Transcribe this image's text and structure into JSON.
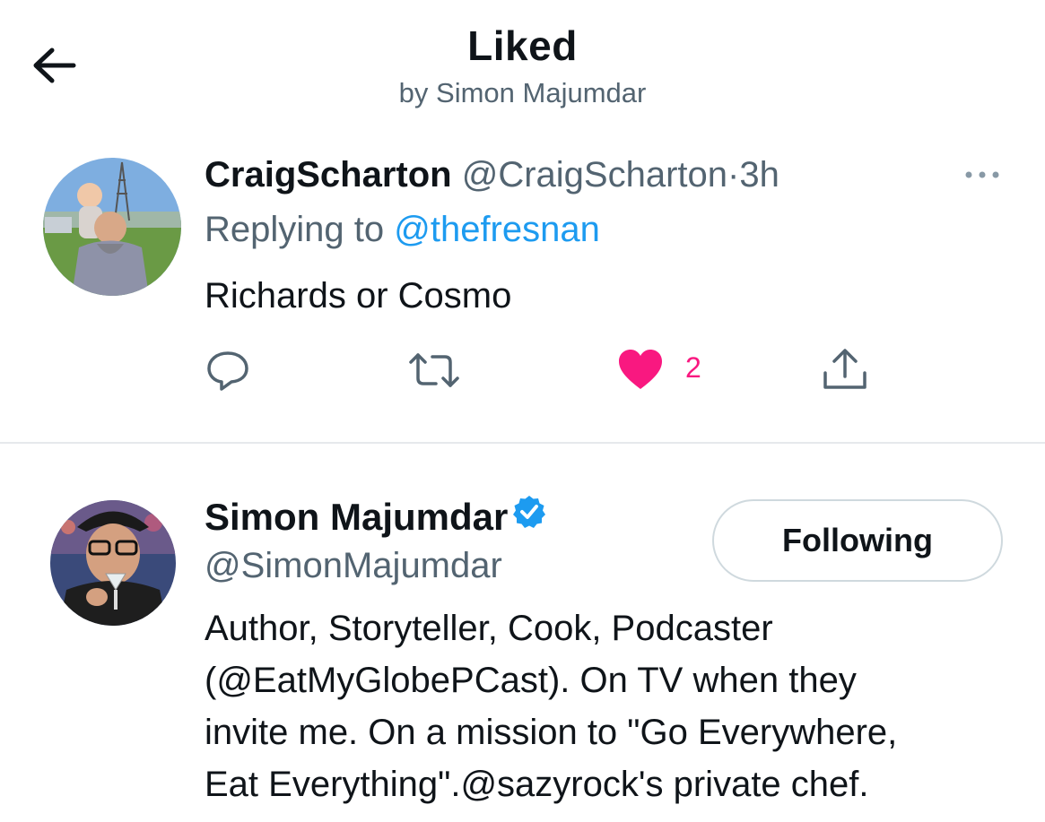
{
  "header": {
    "title": "Liked",
    "subtitle": "by Simon Majumdar"
  },
  "tweet": {
    "author_name": "CraigScharton",
    "author_handle": "@CraigScharton",
    "separator": "·",
    "time": "3h",
    "replying_prefix": "Replying to ",
    "replying_to": "@thefresnan",
    "text": "Richards or Cosmo",
    "like_count": "2",
    "liked": true,
    "like_color": "#f91880"
  },
  "user": {
    "name": "Simon Majumdar",
    "handle": "@SimonMajumdar",
    "verified": true,
    "follow_label": "Following",
    "bio_lines": [
      "Author, Storyteller, Cook, Podcaster",
      "(@EatMyGlobePCast). On TV when they",
      "invite me. On a mission to \"Go Everywhere,",
      "Eat Everything\".@sazyrock's private chef."
    ]
  },
  "colors": {
    "accent": "#1d9bf0",
    "secondary_text": "#536471",
    "primary_text": "#0f1419",
    "like": "#f91880"
  },
  "icons": [
    "back-arrow-icon",
    "more-icon",
    "reply-icon",
    "retweet-icon",
    "heart-icon",
    "share-icon",
    "verified-badge-icon"
  ]
}
